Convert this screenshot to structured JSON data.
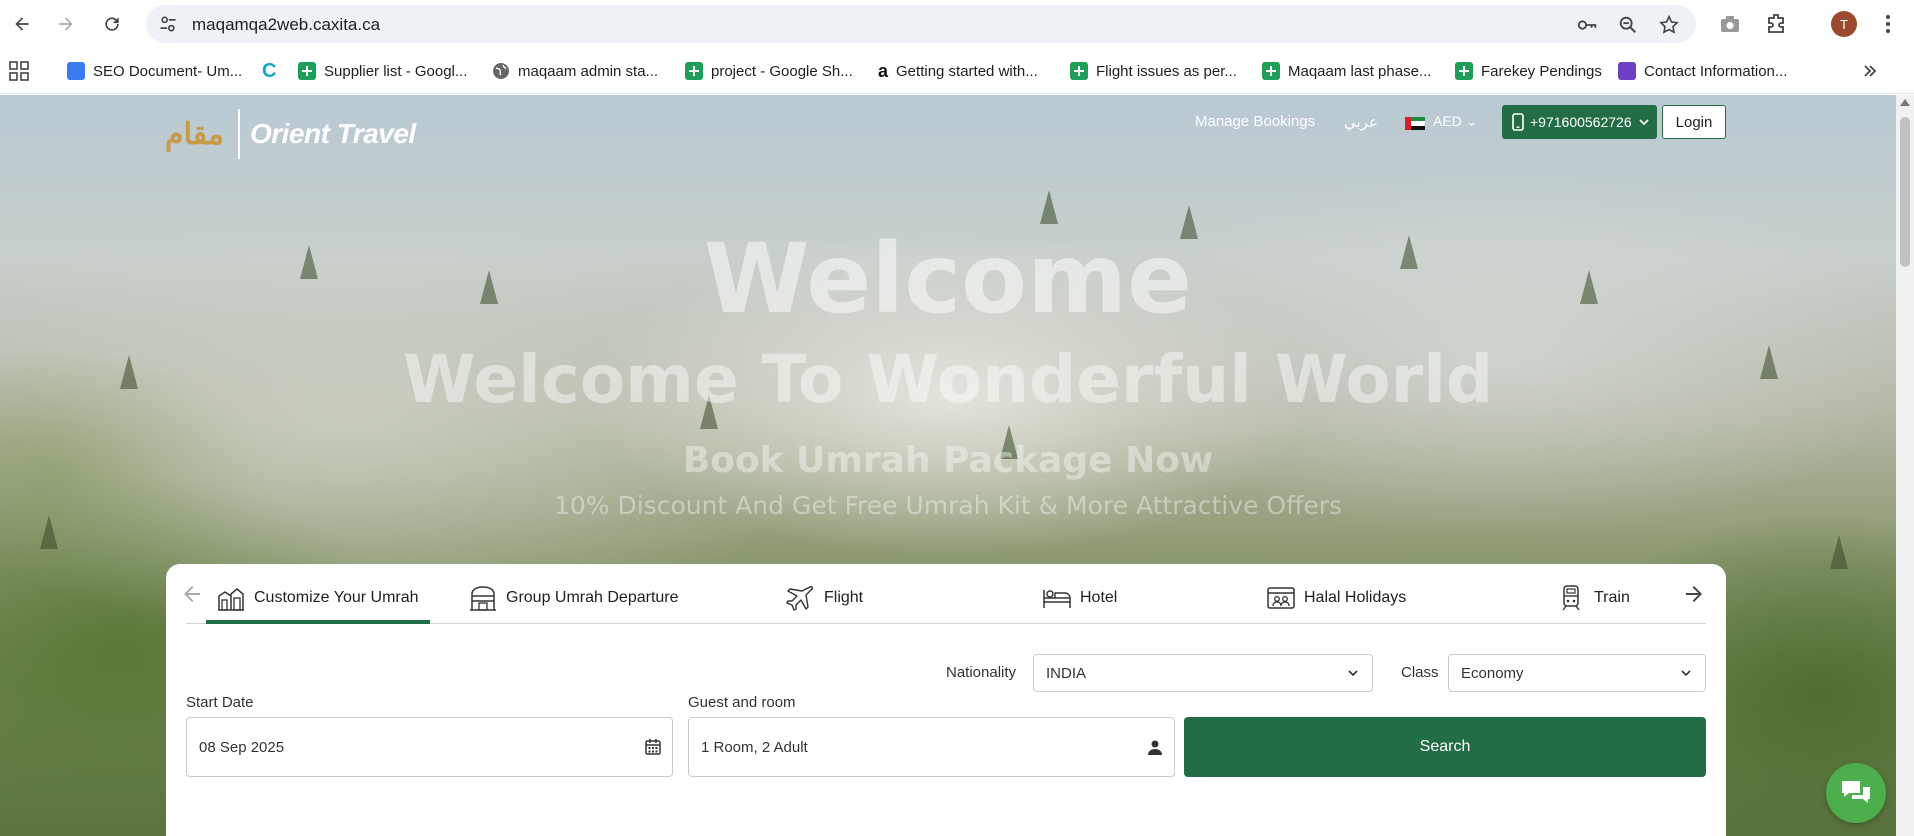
{
  "browser": {
    "url": "maqamqa2web.caxita.ca",
    "profile_initial": "T",
    "bookmarks": [
      {
        "label": "SEO Document- Um...",
        "icon": "docs-icon"
      },
      {
        "label": "",
        "icon": "caxita-icon"
      },
      {
        "label": "Supplier list - Googl...",
        "icon": "sheets-icon"
      },
      {
        "label": "maqaam admin sta...",
        "icon": "globe-icon"
      },
      {
        "label": "project - Google Sh...",
        "icon": "sheets-icon"
      },
      {
        "label": "Getting started with...",
        "icon": "amazon-icon"
      },
      {
        "label": "Flight issues as per...",
        "icon": "sheets-icon"
      },
      {
        "label": "Maqaam last phase...",
        "icon": "sheets-icon"
      },
      {
        "label": "Farekey Pendings",
        "icon": "sheets-icon"
      },
      {
        "label": "Contact Information...",
        "icon": "forms-icon"
      }
    ]
  },
  "site": {
    "logo_maqaam": "مقام",
    "logo_orient": "Orient Travel",
    "nav": {
      "manage_bookings": "Manage Bookings",
      "arabic": "عربي",
      "currency": "AED",
      "phone": "+971600562726",
      "login": "Login"
    },
    "hero": {
      "welcome": "Welcome",
      "headline": "Welcome To Wonderful World",
      "sub1": "Book Umrah Package Now",
      "sub2": "10% Discount And Get Free Umrah Kit & More Attractive Offers"
    },
    "tabs": [
      {
        "label": "Customize Your Umrah",
        "active": true
      },
      {
        "label": "Group Umrah Departure",
        "active": false
      },
      {
        "label": "Flight",
        "active": false
      },
      {
        "label": "Hotel",
        "active": false
      },
      {
        "label": "Halal Holidays",
        "active": false
      },
      {
        "label": "Train",
        "active": false
      }
    ],
    "form": {
      "nationality_label": "Nationality",
      "nationality_value": "INDIA",
      "class_label": "Class",
      "class_value": "Economy",
      "start_date_label": "Start Date",
      "start_date_value": "08 Sep 2025",
      "guest_label": "Guest and room",
      "guest_value": "1 Room, 2 Adult",
      "search_label": "Search"
    }
  },
  "colors": {
    "primary_green": "#226d45",
    "chat_green": "#4cae4c",
    "logo_gold": "#c79a47"
  }
}
